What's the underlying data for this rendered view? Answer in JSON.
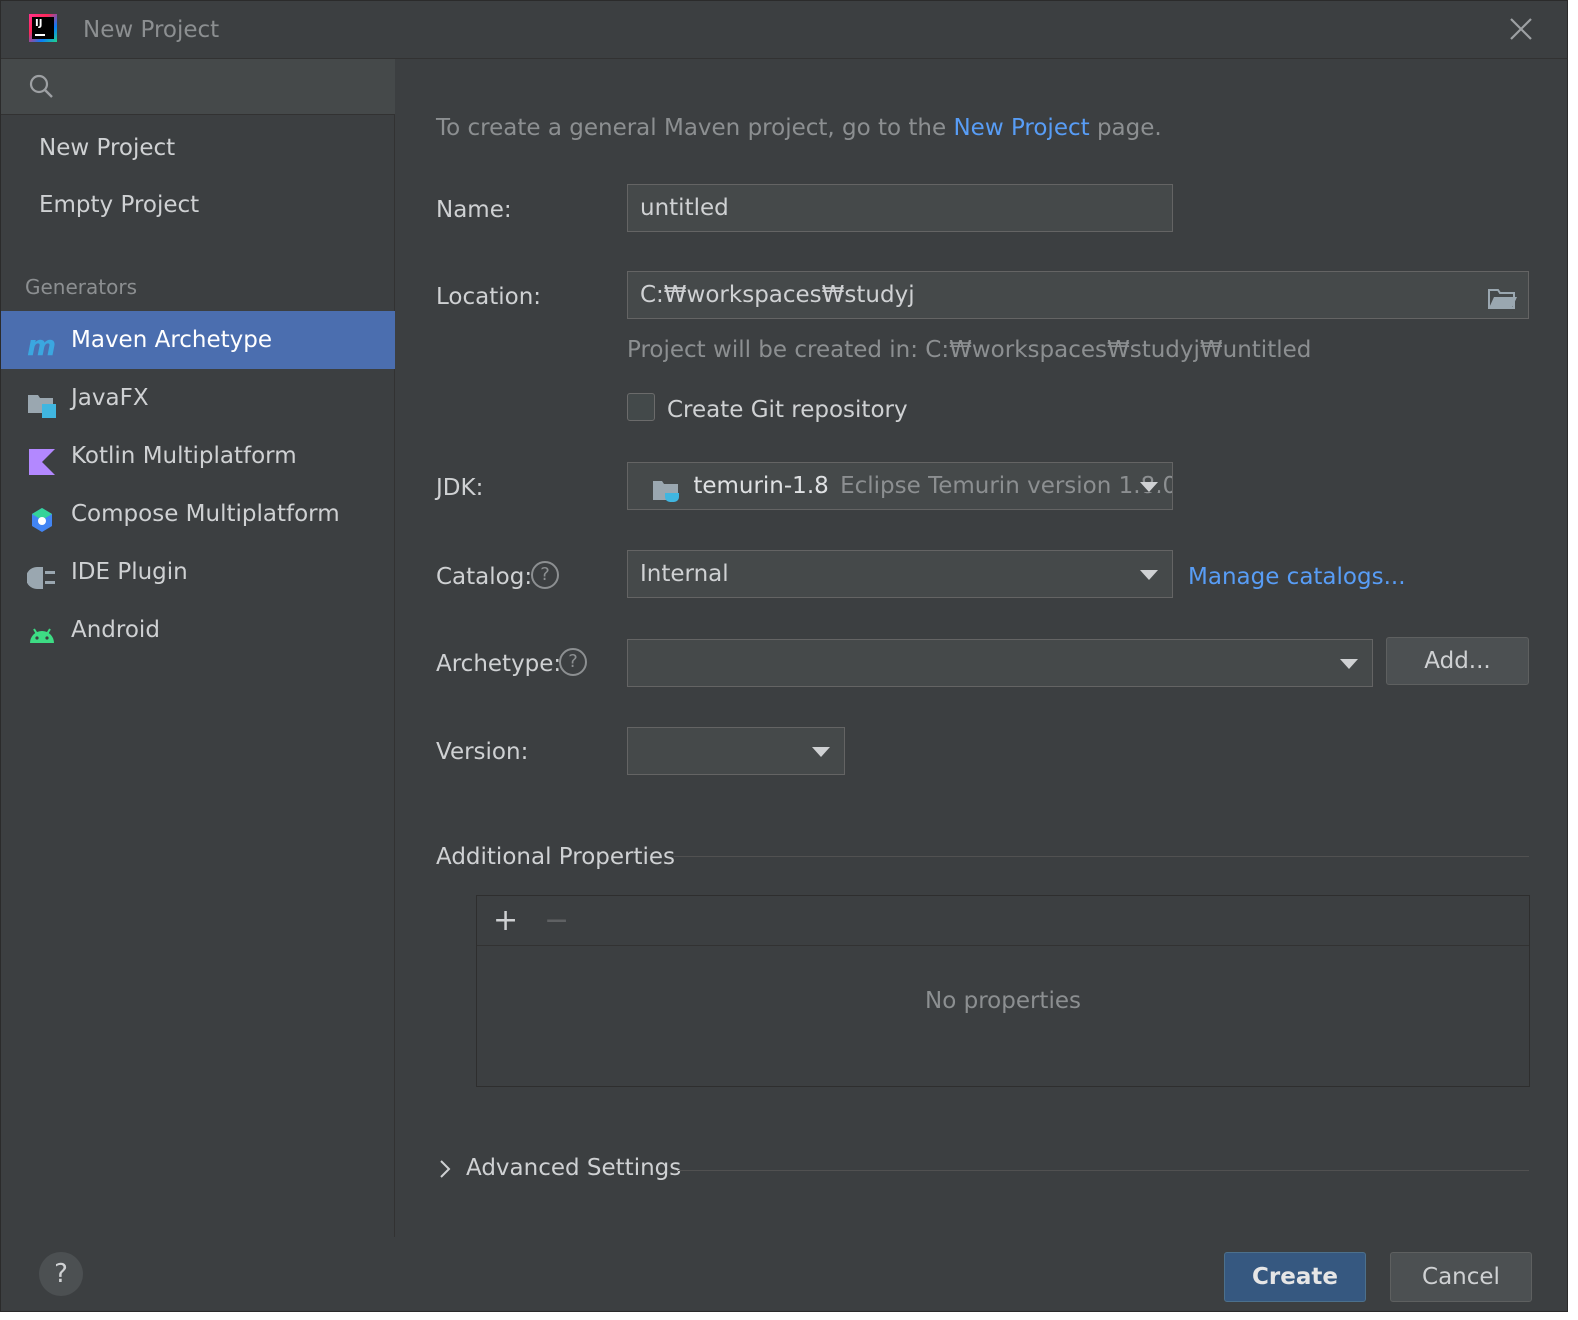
{
  "window": {
    "title": "New Project"
  },
  "sidebar": {
    "search_placeholder": "",
    "items": [
      {
        "label": "New Project"
      },
      {
        "label": "Empty Project"
      }
    ],
    "generators_label": "Generators",
    "generators": [
      {
        "label": "Maven Archetype",
        "icon": "maven-icon",
        "selected": true
      },
      {
        "label": "JavaFX",
        "icon": "javafx-icon"
      },
      {
        "label": "Kotlin Multiplatform",
        "icon": "kotlin-icon"
      },
      {
        "label": "Compose Multiplatform",
        "icon": "compose-icon"
      },
      {
        "label": "IDE Plugin",
        "icon": "plugin-icon"
      },
      {
        "label": "Android",
        "icon": "android-icon"
      }
    ]
  },
  "form": {
    "intro_prefix": "To create a general Maven project, go to the",
    "intro_link": "New Project",
    "intro_suffix": "page.",
    "name_label": "Name:",
    "name_value": "untitled",
    "location_label": "Location:",
    "location_value": "C:₩workspaces₩studyj",
    "location_hint": "Project will be created in: C:₩workspaces₩studyj₩untitled",
    "git_label": "Create Git repository",
    "git_checked": false,
    "jdk_label": "JDK:",
    "jdk_name": "temurin-1.8",
    "jdk_desc": "Eclipse Temurin version 1.8.0",
    "catalog_label": "Catalog:",
    "catalog_value": "Internal",
    "manage_catalogs": "Manage catalogs...",
    "archetype_label": "Archetype:",
    "archetype_value": "",
    "add_button": "Add...",
    "version_label": "Version:",
    "version_value": ""
  },
  "additional": {
    "title": "Additional Properties",
    "plus": "+",
    "minus": "−",
    "empty_text": "No properties"
  },
  "advanced": {
    "title": "Advanced Settings"
  },
  "footer": {
    "help": "?",
    "create": "Create",
    "cancel": "Cancel"
  },
  "colors": {
    "background": "#3c3f41",
    "selection": "#4b6eaf",
    "link": "#589df6",
    "primary_button": "#365880"
  }
}
